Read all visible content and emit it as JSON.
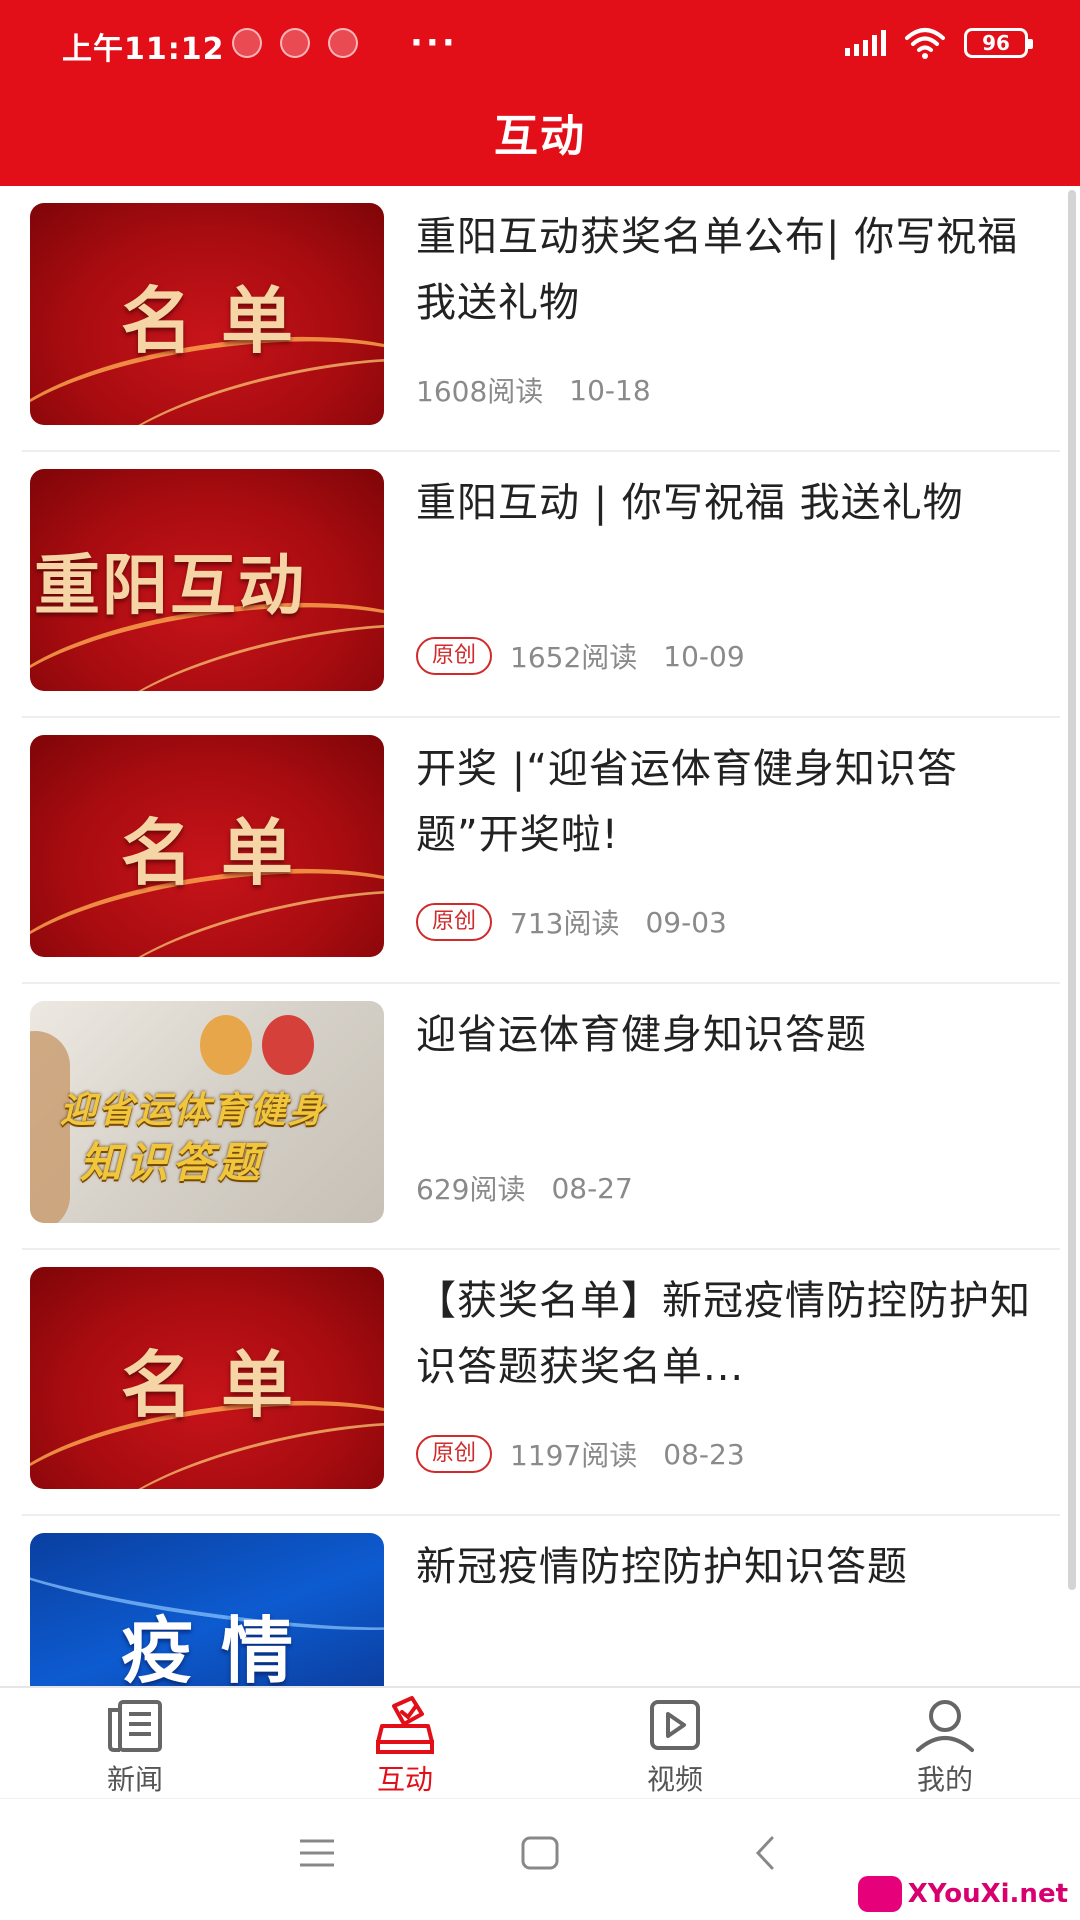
{
  "status_bar": {
    "time": "上午11:12",
    "dots": "···",
    "battery": "96"
  },
  "header": {
    "title": "互动"
  },
  "articles": [
    {
      "thumb_text": "名单",
      "title": "重阳互动获奖名单公布| 你写祝福  我送礼物",
      "tag": "",
      "reads": "1608阅读",
      "date": "10-18"
    },
    {
      "thumb_text": "重阳互动",
      "title": "重阳互动 | 你写祝福  我送礼物",
      "tag": "原创",
      "reads": "1652阅读",
      "date": "10-09"
    },
    {
      "thumb_text": "名单",
      "title": "开奖 |“迎省运体育健身知识答题”开奖啦!",
      "tag": "原创",
      "reads": "713阅读",
      "date": "09-03"
    },
    {
      "thumb_text_line1": "迎省运体育健身",
      "thumb_text_line2": "知识答题",
      "title": "迎省运体育健身知识答题",
      "tag": "",
      "reads": "629阅读",
      "date": "08-27"
    },
    {
      "thumb_text": "名单",
      "title": "【获奖名单】新冠疫情防控防护知识答题获奖名单...",
      "tag": "原创",
      "reads": "1197阅读",
      "date": "08-23"
    },
    {
      "thumb_text": "疫情",
      "title": "新冠疫情防控防护知识答题"
    }
  ],
  "tabs": [
    {
      "label": "新闻",
      "icon": "newspaper-icon",
      "active": false
    },
    {
      "label": "互动",
      "icon": "ballot-box-icon",
      "active": true
    },
    {
      "label": "视频",
      "icon": "play-icon",
      "active": false
    },
    {
      "label": "我的",
      "icon": "person-icon",
      "active": false
    }
  ],
  "watermark": {
    "text": "XYouXi.net"
  },
  "colors": {
    "brand_red": "#e30f18",
    "tag_red": "#d02a2a",
    "meta_gray": "#8a8a8a"
  }
}
